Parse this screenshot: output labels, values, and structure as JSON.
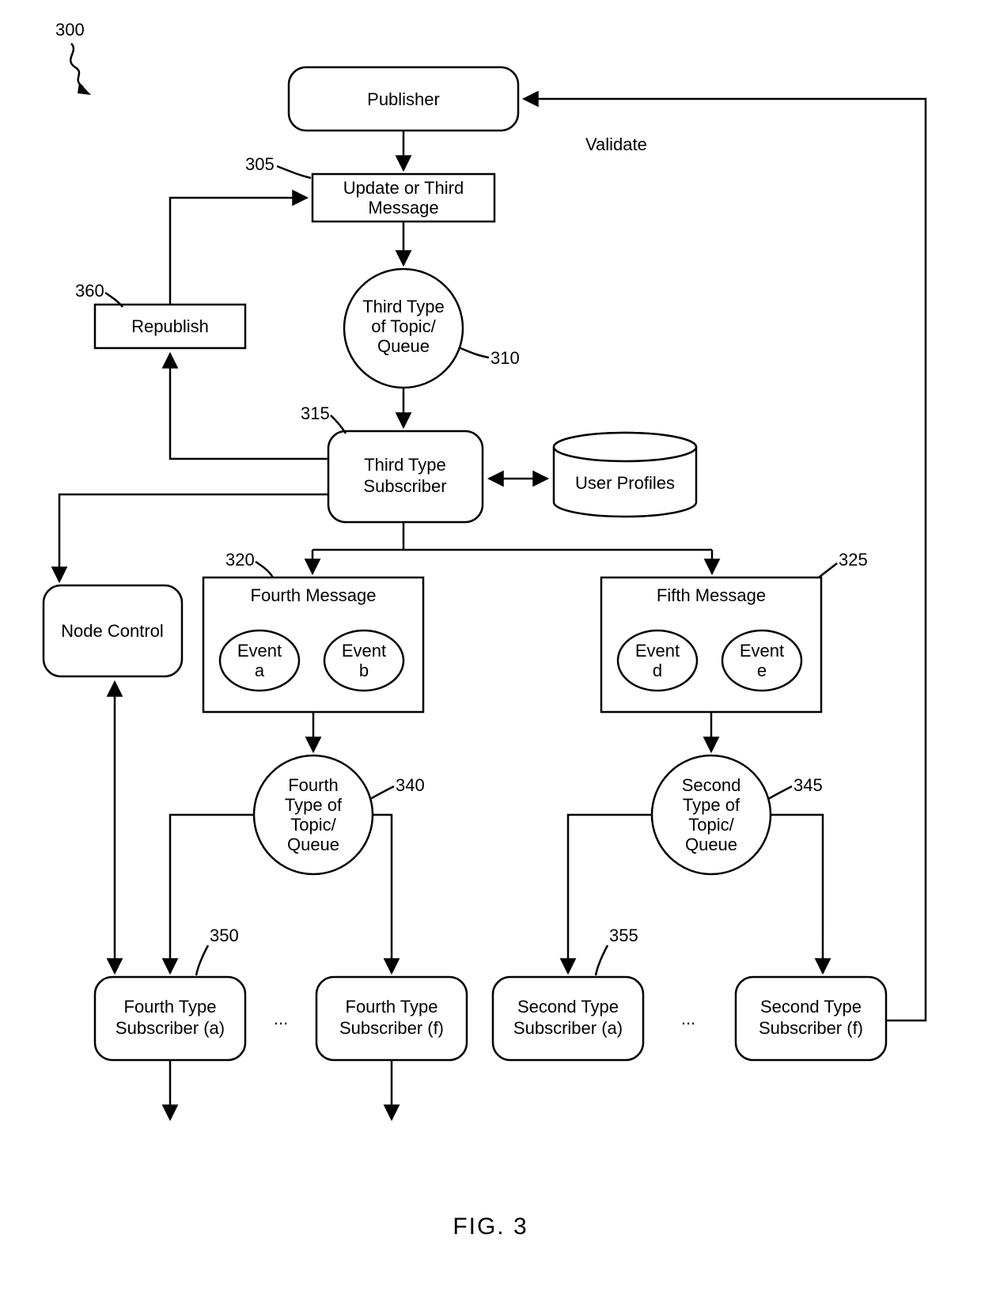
{
  "figure_ref": "300",
  "figure_caption": "FIG. 3",
  "nodes": {
    "publisher": "Publisher",
    "update_msg_l1": "Update or Third",
    "update_msg_l2": "Message",
    "third_topic_l1": "Third Type",
    "third_topic_l2": "of Topic/",
    "third_topic_l3": "Queue",
    "republish": "Republish",
    "third_sub_l1": "Third Type",
    "third_sub_l2": "Subscriber",
    "user_profiles": "User Profiles",
    "node_control": "Node Control",
    "fourth_msg_title": "Fourth Message",
    "fifth_msg_title": "Fifth Message",
    "event_a_l1": "Event",
    "event_a_l2": "a",
    "event_b_l1": "Event",
    "event_b_l2": "b",
    "event_d_l1": "Event",
    "event_d_l2": "d",
    "event_e_l1": "Event",
    "event_e_l2": "e",
    "fourth_topic_l1": "Fourth",
    "fourth_topic_l2": "Type of",
    "fourth_topic_l3": "Topic/",
    "fourth_topic_l4": "Queue",
    "second_topic_l1": "Second",
    "second_topic_l2": "Type of",
    "second_topic_l3": "Topic/",
    "second_topic_l4": "Queue",
    "fourth_sub_a_l1": "Fourth Type",
    "fourth_sub_a_l2": "Subscriber (a)",
    "fourth_sub_f_l1": "Fourth Type",
    "fourth_sub_f_l2": "Subscriber (f)",
    "second_sub_a_l1": "Second Type",
    "second_sub_a_l2": "Subscriber (a)",
    "second_sub_f_l1": "Second Type",
    "second_sub_f_l2": "Subscriber (f)"
  },
  "labels": {
    "validate": "Validate",
    "ellipsis1": "...",
    "ellipsis2": "..."
  },
  "refs": {
    "r305": "305",
    "r310": "310",
    "r315": "315",
    "r320": "320",
    "r325": "325",
    "r340": "340",
    "r345": "345",
    "r350": "350",
    "r355": "355",
    "r360": "360"
  }
}
